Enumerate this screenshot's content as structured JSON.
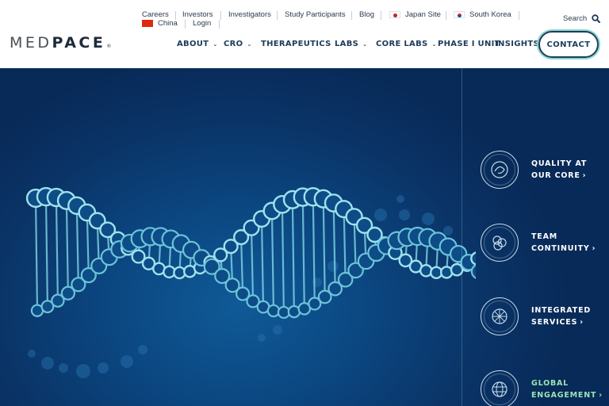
{
  "logo": {
    "part1": "MED",
    "part2": "PACE",
    "mark": "®"
  },
  "utility": {
    "careers": "Careers",
    "investors": "Investors",
    "investigators": "Investigators",
    "study_participants": "Study Participants",
    "blog": "Blog",
    "japan": "Japan Site",
    "korea": "South Korea",
    "china": "China",
    "login": "Login"
  },
  "search": {
    "label": "Search"
  },
  "nav": {
    "about": "ABOUT",
    "cro": "CRO",
    "therapeutics": "THERAPEUTICS",
    "labs": "LABS",
    "core_labs": "CORE LABS",
    "phase1": "PHASE I UNIT",
    "insights": "INSIGHTS",
    "contact": "CONTACT"
  },
  "features": [
    {
      "line1": "QUALITY AT",
      "line2": "OUR CORE",
      "icon": "quality-icon"
    },
    {
      "line1": "TEAM",
      "line2": "CONTINUITY",
      "icon": "team-icon"
    },
    {
      "line1": "INTEGRATED",
      "line2": "SERVICES",
      "icon": "services-icon"
    },
    {
      "line1": "GLOBAL",
      "line2": "ENGAGEMENT",
      "icon": "globe-icon"
    }
  ],
  "colors": {
    "brand_navy": "#1b3d5d",
    "accent_teal": "#8ad6cc",
    "hero_blue": "#0b4680",
    "dna_cyan": "#7fd6e6",
    "global_green": "#9be3b6"
  }
}
